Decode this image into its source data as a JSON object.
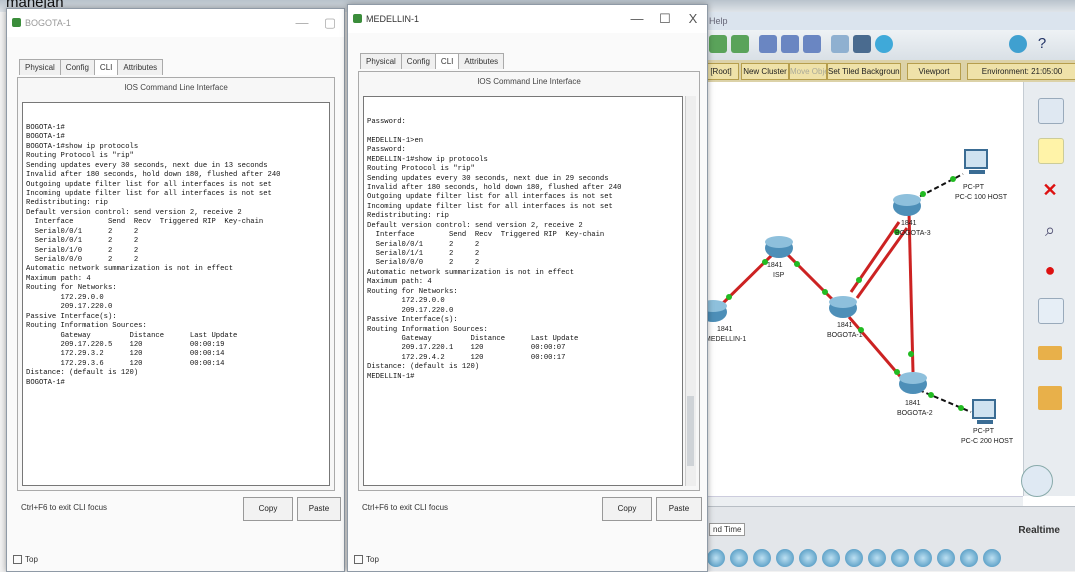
{
  "background_word": "manejan",
  "bogota_window": {
    "title": "BOGOTA-1",
    "tabs": [
      "Physical",
      "Config",
      "CLI",
      "Attributes"
    ],
    "active_tab": "CLI",
    "panel_title": "IOS Command Line Interface",
    "console_lines": [
      "BOGOTA-1#",
      "BOGOTA-1#",
      "BOGOTA-1#show ip protocols",
      "Routing Protocol is \"rip\"",
      "Sending updates every 30 seconds, next due in 13 seconds",
      "Invalid after 180 seconds, hold down 180, flushed after 240",
      "Outgoing update filter list for all interfaces is not set",
      "Incoming update filter list for all interfaces is not set",
      "Redistributing: rip",
      "Default version control: send version 2, receive 2",
      "  Interface        Send  Recv  Triggered RIP  Key-chain",
      "  Serial0/0/1      2     2",
      "  Serial0/0/1      2     2",
      "  Serial0/1/0      2     2",
      "  Serial0/0/0      2     2",
      "Automatic network summarization is not in effect",
      "Maximum path: 4",
      "Routing for Networks:",
      "        172.29.0.0",
      "        209.17.220.0",
      "Passive Interface(s):",
      "Routing Information Sources:",
      "        Gateway         Distance      Last Update",
      "        209.17.220.5    120           00:00:19",
      "        172.29.3.2      120           00:00:14",
      "        172.29.3.6      120           00:00:14",
      "Distance: (default is 120)",
      "BOGOTA-1#"
    ],
    "focus_hint": "Ctrl+F6 to exit CLI focus",
    "copy_label": "Copy",
    "paste_label": "Paste",
    "top_checkbox": "Top",
    "win_minimize": "—",
    "win_maximize": "▢"
  },
  "medellin_window": {
    "title": "MEDELLIN-1",
    "tabs": [
      "Physical",
      "Config",
      "CLI",
      "Attributes"
    ],
    "active_tab": "CLI",
    "panel_title": "IOS Command Line Interface",
    "console_lines": [
      "Password:",
      "",
      "MEDELLIN-1>en",
      "Password:",
      "MEDELLIN-1#show ip protocols",
      "Routing Protocol is \"rip\"",
      "Sending updates every 30 seconds, next due in 29 seconds",
      "Invalid after 180 seconds, hold down 180, flushed after 240",
      "Outgoing update filter list for all interfaces is not set",
      "Incoming update filter list for all interfaces is not set",
      "Redistributing: rip",
      "Default version control: send version 2, receive 2",
      "  Interface        Send  Recv  Triggered RIP  Key-chain",
      "  Serial0/0/1      2     2",
      "  Serial0/1/1      2     2",
      "  Serial0/0/0      2     2",
      "Automatic network summarization is not in effect",
      "Maximum path: 4",
      "Routing for Networks:",
      "        172.29.0.0",
      "        209.17.220.0",
      "Passive Interface(s):",
      "Routing Information Sources:",
      "        Gateway         Distance      Last Update",
      "        209.17.220.1    120           00:00:07",
      "        172.29.4.2      120           00:00:17",
      "Distance: (default is 120)",
      "MEDELLIN-1#"
    ],
    "focus_hint": "Ctrl+F6 to exit CLI focus",
    "copy_label": "Copy",
    "paste_label": "Paste",
    "top_checkbox": "Top",
    "win_minimize": "—",
    "win_maximize": "☐",
    "win_close": "X"
  },
  "packet_tracer": {
    "title_fragment": "Help",
    "toolbar_buttons": [
      "[Root]",
      "New Cluster",
      "Move Object",
      "Set Tiled Background",
      "Viewport",
      "Environment: 21:05:00"
    ],
    "bottom_tab": "Realtime",
    "bottom_left_tab": "nd Time",
    "right_tools": [
      "select-icon",
      "note-icon",
      "delete-icon",
      "inspect-icon",
      "draw-icon",
      "resize-icon",
      "simple-pdu-icon",
      "complex-pdu-icon"
    ],
    "devices": [
      {
        "name": "PC-C 100 HOST",
        "model": "PC-PT"
      },
      {
        "name": "BOGOTA-3",
        "model": "1841"
      },
      {
        "name": "ISP",
        "model": "1841"
      },
      {
        "name": "MEDELLIN-1",
        "model": "1841"
      },
      {
        "name": "BOGOTA-1",
        "model": "1841"
      },
      {
        "name": "BOGOTA-2",
        "model": "1841"
      },
      {
        "name": "PC-C 200 HOST",
        "model": "PC-PT"
      }
    ],
    "colors": {
      "serial_link": "#cc2222",
      "link_up": "#22bb22",
      "router": "#4d8fb8"
    }
  }
}
